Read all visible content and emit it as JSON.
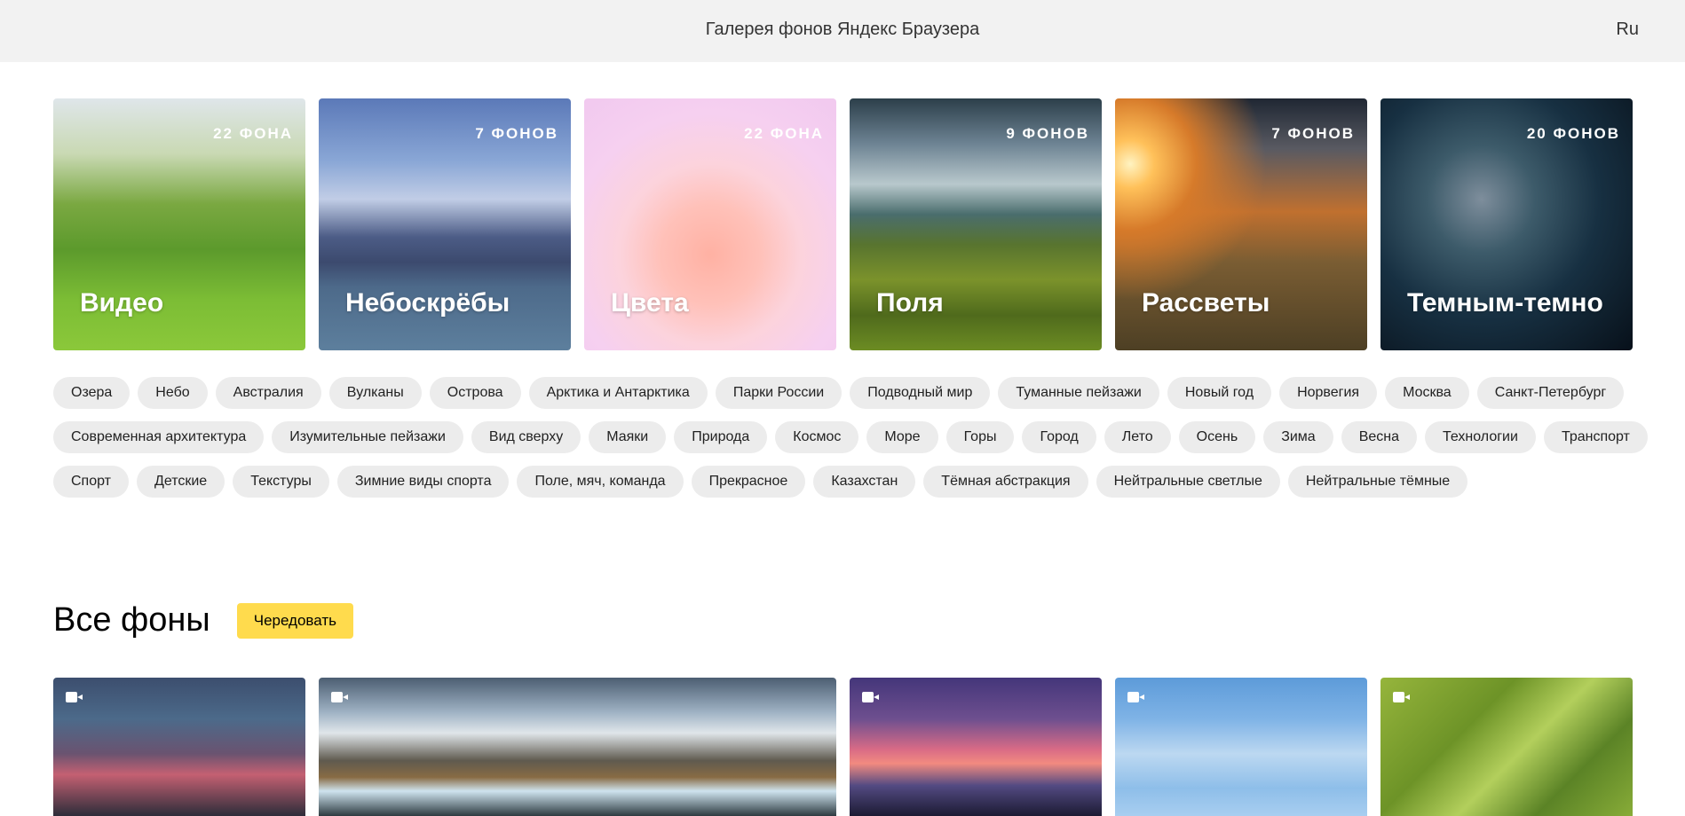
{
  "header": {
    "title": "Галерея фонов Яндекс Браузера",
    "lang": "Ru"
  },
  "collections": [
    {
      "name": "Видео",
      "count": "22 ФОНА"
    },
    {
      "name": "Небоскрёбы",
      "count": "7 ФОНОВ"
    },
    {
      "name": "Цвета",
      "count": "22 ФОНА"
    },
    {
      "name": "Поля",
      "count": "9 ФОНОВ"
    },
    {
      "name": "Рассветы",
      "count": "7 ФОНОВ"
    },
    {
      "name": "Темным-темно",
      "count": "20 ФОНОВ"
    }
  ],
  "tags": [
    "Озера",
    "Небо",
    "Австралия",
    "Вулканы",
    "Острова",
    "Арктика и Антарктика",
    "Парки России",
    "Подводный мир",
    "Туманные пейзажи",
    "Новый год",
    "Норвегия",
    "Москва",
    "Санкт-Петербург",
    "Современная архитектура",
    "Изумительные пейзажи",
    "Вид сверху",
    "Маяки",
    "Природа",
    "Космос",
    "Море",
    "Горы",
    "Город",
    "Лето",
    "Осень",
    "Зима",
    "Весна",
    "Технологии",
    "Транспорт",
    "Спорт",
    "Детские",
    "Текстуры",
    "Зимние виды спорта",
    "Поле, мяч, команда",
    "Прекрасное",
    "Казахстан",
    "Тёмная абстракция",
    "Нейтральные светлые",
    "Нейтральные тёмные"
  ],
  "all_section": {
    "title": "Все фоны",
    "shuffle_label": "Чередовать"
  },
  "wallpaper_icons": [
    "video-camera-icon",
    "video-camera-icon",
    "video-camera-icon",
    "video-camera-icon",
    "video-camera-icon"
  ]
}
